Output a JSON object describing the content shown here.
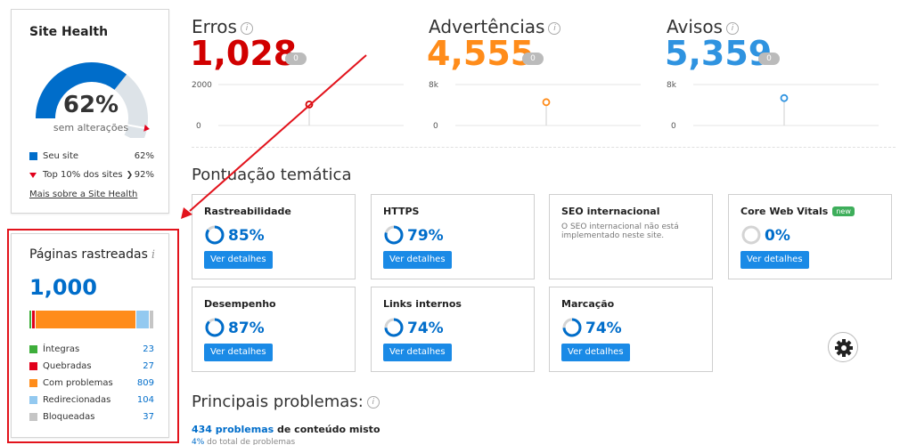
{
  "site_health": {
    "title": "Site Health",
    "percent": "62%",
    "percent_value": 62,
    "subtitle": "sem alterações",
    "legend": [
      {
        "label": "Seu site",
        "value": "62%"
      },
      {
        "label": "Top 10% dos sites",
        "value": "92%"
      }
    ],
    "top10_value": 92,
    "more_link": "Mais sobre a Site Health",
    "colors": {
      "site": "#006dca",
      "top": "#e1001b",
      "track": "#dde3e8"
    }
  },
  "pages": {
    "title": "Páginas rastreadas",
    "info": "i",
    "total": "1,000",
    "legend": [
      {
        "label": "Íntegras",
        "value": "23",
        "count": 23,
        "color": "#3eae3b"
      },
      {
        "label": "Quebradas",
        "value": "27",
        "count": 27,
        "color": "#e1001b"
      },
      {
        "label": "Com problemas",
        "value": "809",
        "count": 809,
        "color": "#ff8c1a"
      },
      {
        "label": "Redirecionadas",
        "value": "104",
        "count": 104,
        "color": "#93c9f0"
      },
      {
        "label": "Bloqueadas",
        "value": "37",
        "count": 37,
        "color": "#c5c5c5"
      }
    ]
  },
  "metrics": [
    {
      "title": "Erros",
      "value": "1,028",
      "color": "#d10000",
      "badge": "0",
      "y_top": "2000",
      "y_bottom": "0",
      "max": 2000,
      "current": 1028
    },
    {
      "title": "Advertências",
      "value": "4,555",
      "color": "#ff8c1a",
      "badge": "0",
      "y_top": "8k",
      "y_bottom": "0",
      "max": 8000,
      "current": 4555
    },
    {
      "title": "Avisos",
      "value": "5,359",
      "color": "#2f93e0",
      "badge": "0",
      "y_top": "8k",
      "y_bottom": "0",
      "max": 8000,
      "current": 5359
    }
  ],
  "thematic": {
    "title": "Pontuação temática",
    "button_label": "Ver detalhes",
    "cards": [
      {
        "name": "Rastreabilidade",
        "score": "85%",
        "value": 85
      },
      {
        "name": "HTTPS",
        "score": "79%",
        "value": 79
      },
      {
        "name": "SEO internacional",
        "desc": "O SEO internacional não está implementado neste site."
      },
      {
        "name": "Core Web Vitals",
        "badge": "new",
        "score": "0%",
        "value": 0
      },
      {
        "name": "Desempenho",
        "score": "87%",
        "value": 87
      },
      {
        "name": "Links internos",
        "score": "74%",
        "value": 74
      },
      {
        "name": "Marcação",
        "score": "74%",
        "value": 74
      }
    ]
  },
  "issues": {
    "title": "Principais problemas:",
    "first_count": "434 problemas",
    "first_text": " de conteúdo misto",
    "first_pct": "4%",
    "first_sub": " do total de problemas"
  }
}
